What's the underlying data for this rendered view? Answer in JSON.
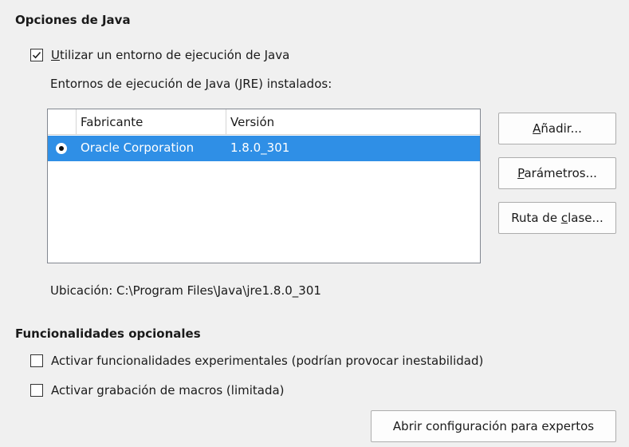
{
  "java_options": {
    "heading": "Opciones de Java",
    "use_jre": {
      "mnemonic": "U",
      "label_rest": "tilizar un entorno de ejecución de Java",
      "checked": true
    },
    "installed_label_pre": "Entornos de ejecución de ",
    "installed_label_mnemonic": "J",
    "installed_label_post": "ava (JRE) instalados:",
    "table": {
      "columns": [
        "",
        "Fabricante",
        "Versión"
      ],
      "rows": [
        {
          "selected": true,
          "vendor": "Oracle Corporation",
          "version": "1.8.0_301"
        }
      ]
    },
    "buttons": {
      "add": {
        "mnemonic": "A",
        "rest": "ñadir..."
      },
      "params": {
        "mnemonic": "P",
        "rest": "arámetros..."
      },
      "classpath": {
        "pre": "Ruta de ",
        "mnemonic": "c",
        "rest": "lase..."
      }
    },
    "location": "Ubicación: C:\\Program Files\\Java\\jre1.8.0_301"
  },
  "optional_features": {
    "heading": "Funcionalidades opcionales",
    "experimental": {
      "label": "Activar funcionalidades experimentales (podrían provocar inestabilidad)",
      "checked": false
    },
    "macro_recording": {
      "label": "Activar grabación de macros (limitada)",
      "checked": false
    },
    "expert_button": "Abrir configuración para expertos"
  },
  "colors": {
    "background": "#f0f0f0",
    "selection": "#2f8fe6"
  }
}
